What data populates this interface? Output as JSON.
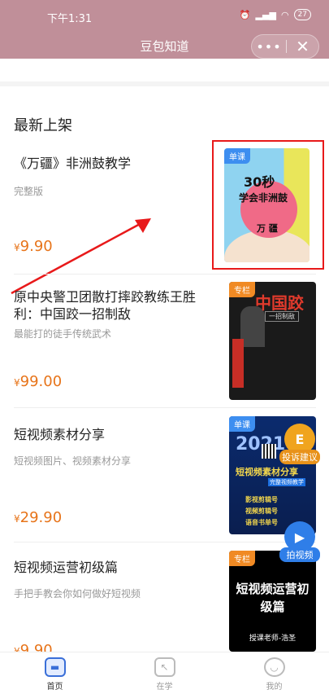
{
  "status": {
    "time": "下午1:31",
    "battery": "27"
  },
  "nav": {
    "title": "豆包知道",
    "more": "•••",
    "close": "✕"
  },
  "section_title": "最新上架",
  "items": [
    {
      "title": "《万疆》非洲鼓教学",
      "desc": "完整版",
      "price": "9.90",
      "badge": "单课",
      "cover": {
        "t1": "30秒",
        "t2": "学会非洲鼓",
        "t3": "万  疆"
      }
    },
    {
      "title": "原中央警卫团散打摔跤教练王胜利：中国跤一招制敌",
      "desc": "最能打的徒手传统武术",
      "price": "99.00",
      "badge": "专栏",
      "cover": {
        "t1": "中国跤",
        "t2": "一招制敌"
      }
    },
    {
      "title": "短视频素材分享",
      "desc": "短视频图片、视频素材分享",
      "price": "29.90",
      "badge": "单课",
      "cover": {
        "yr": "2021",
        "main": "短视频素材分享",
        "sub": "完整视频教学",
        "rows": [
          "影视剪辑号",
          "视频剪辑号",
          "语音书单号"
        ]
      }
    },
    {
      "title": "短视频运营初级篇",
      "desc": "手把手教会你如何做好短视频",
      "price": "9.90",
      "badge": "专栏",
      "cover": {
        "t1": "短视频运营初级篇",
        "t2": "授课老师-浩圣"
      }
    }
  ],
  "currency": "¥",
  "floating": {
    "complain": "投诉建议",
    "camera": "拍视频"
  },
  "tabs": [
    {
      "label": "首页",
      "active": true
    },
    {
      "label": "在学",
      "active": false
    },
    {
      "label": "我的",
      "active": false
    }
  ],
  "colors": {
    "header": "#c08f99",
    "price": "#e7741a",
    "highlight": "#e8191a"
  }
}
